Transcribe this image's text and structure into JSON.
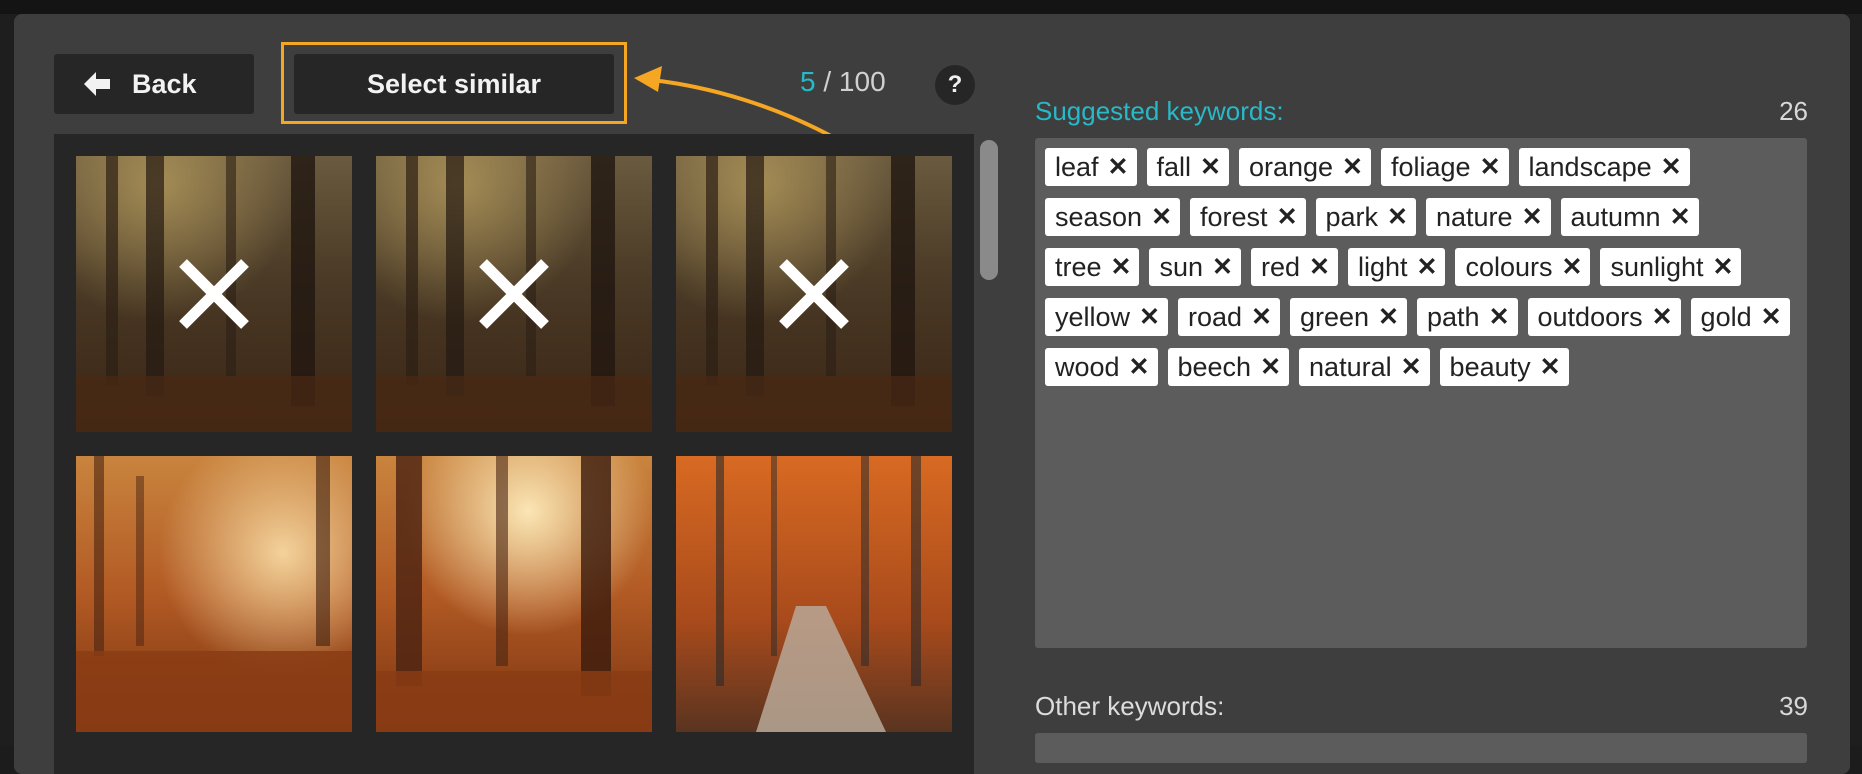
{
  "toolbar": {
    "back_label": "Back",
    "select_similar_label": "Select similar",
    "counter_current": "5",
    "counter_sep": " / ",
    "counter_total": "100",
    "help_label": "?"
  },
  "colors": {
    "accent": "#28b9c8",
    "highlight": "#f5a623",
    "panel": "#5c5c5c",
    "modal": "#3e3e3e"
  },
  "grid": {
    "images": [
      {
        "scene": "misty-forest",
        "rejected": true
      },
      {
        "scene": "misty-forest",
        "rejected": true
      },
      {
        "scene": "misty-forest",
        "rejected": true
      },
      {
        "scene": "autumn-sunlit-forest",
        "rejected": false
      },
      {
        "scene": "autumn-tall-trees-sunbeams",
        "rejected": false
      },
      {
        "scene": "autumn-forest-path",
        "rejected": false
      }
    ],
    "reject_icon": "close-icon"
  },
  "suggested": {
    "title": "Suggested keywords:",
    "count": "26",
    "keywords": [
      "leaf",
      "fall",
      "orange",
      "foliage",
      "landscape",
      "season",
      "forest",
      "park",
      "nature",
      "autumn",
      "tree",
      "sun",
      "red",
      "light",
      "colours",
      "sunlight",
      "yellow",
      "road",
      "green",
      "path",
      "outdoors",
      "gold",
      "wood",
      "beech",
      "natural",
      "beauty"
    ],
    "remove_glyph": "✕"
  },
  "other": {
    "title": "Other keywords:",
    "count": "39"
  }
}
